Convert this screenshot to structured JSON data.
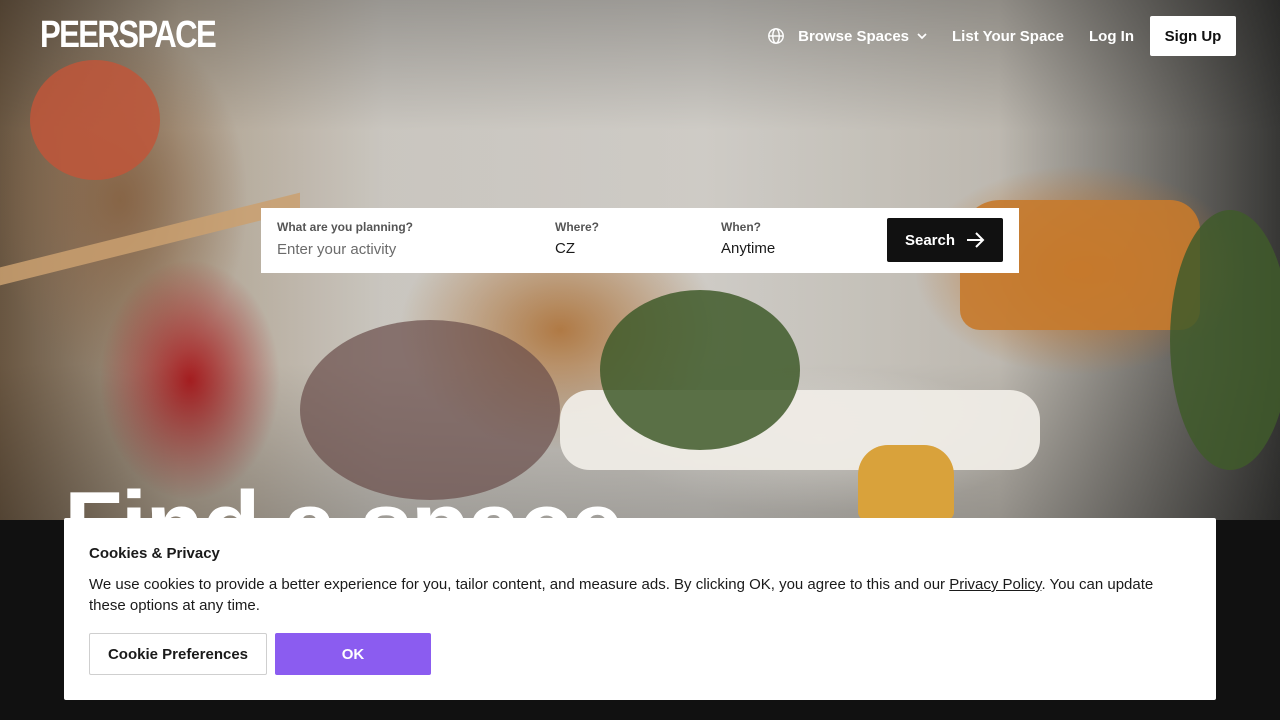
{
  "brand": {
    "logo_text": "PEERSPACE"
  },
  "nav": {
    "browse_label": "Browse Spaces",
    "list_label": "List Your Space",
    "login_label": "Log In",
    "signup_label": "Sign Up"
  },
  "hero": {
    "headline": "Find a space"
  },
  "search": {
    "activity_label": "What are you planning?",
    "activity_placeholder": "Enter your activity",
    "where_label": "Where?",
    "where_value": "CZ",
    "when_label": "When?",
    "when_value": "Anytime",
    "button_label": "Search"
  },
  "cookie": {
    "title": "Cookies & Privacy",
    "text_before": "We use cookies to provide a better experience for you, tailor content, and measure ads. By clicking OK, you agree to this and our ",
    "link_text": "Privacy Policy",
    "text_after": ". You can update these options at any time.",
    "preferences_label": "Cookie Preferences",
    "ok_label": "OK"
  },
  "colors": {
    "accent": "#8b5cf0",
    "dark": "#111111",
    "white": "#ffffff"
  },
  "icons": {
    "language": "globe-icon",
    "dropdown": "chevron-down-icon",
    "search_arrow": "arrow-right-icon"
  }
}
